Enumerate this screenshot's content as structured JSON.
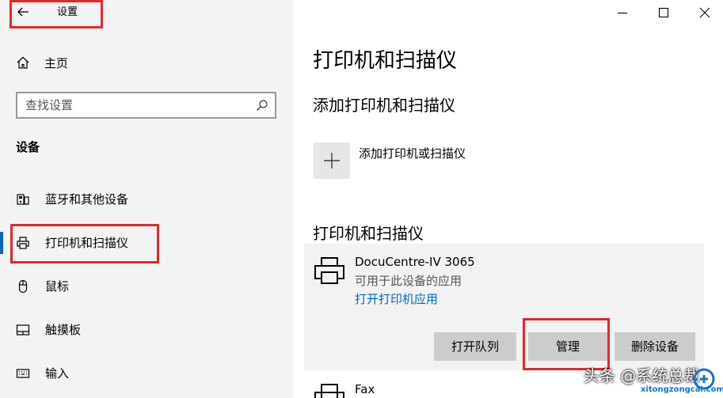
{
  "app": {
    "title": "设置"
  },
  "sidebar": {
    "home_label": "主页",
    "search_placeholder": "查找设置",
    "group_title": "设备",
    "items": [
      {
        "label": "蓝牙和其他设备",
        "icon": "bluetooth-devices-icon",
        "active": false
      },
      {
        "label": "打印机和扫描仪",
        "icon": "printer-icon",
        "active": true
      },
      {
        "label": "鼠标",
        "icon": "mouse-icon",
        "active": false
      },
      {
        "label": "触摸板",
        "icon": "touchpad-icon",
        "active": false
      },
      {
        "label": "输入",
        "icon": "keyboard-icon",
        "active": false
      }
    ]
  },
  "main": {
    "page_title": "打印机和扫描仪",
    "add_section_title": "添加打印机和扫描仪",
    "add_button_label": "添加打印机或扫描仪",
    "list_section_title": "打印机和扫描仪",
    "printers": [
      {
        "name": "DocuCentre-IV 3065",
        "app_text": "可用于此设备的应用",
        "app_link": "打开打印机应用",
        "buttons": {
          "queue": "打开队列",
          "manage": "管理",
          "remove": "删除设备"
        }
      },
      {
        "name": "Fax"
      }
    ]
  },
  "watermark": {
    "text": "头条 @系统总裁",
    "url": "xitongzongcai.com"
  },
  "colors": {
    "accent": "#0067c0",
    "highlight_box": "#e0292d",
    "sidebar_bg": "#f2f3f3",
    "card_bg": "#f2f2f2",
    "button_bg": "#cccccc"
  }
}
